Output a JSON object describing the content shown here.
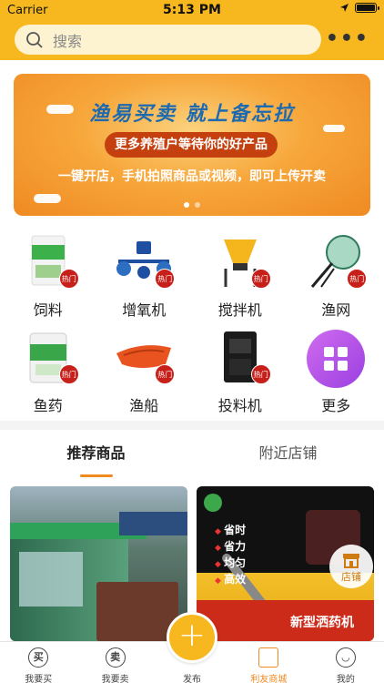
{
  "status_bar": {
    "carrier": "Carrier",
    "time": "5:13 PM",
    "battery_level": 1.0
  },
  "header": {
    "search_placeholder": "搜索",
    "more_icon": "ellipsis-icon"
  },
  "banner": {
    "title": "渔易买卖 就上备忘拉",
    "pill": "更多养殖户等待你的好产品",
    "subtitle": "一键开店，手机拍照商品或视频，即可上传开卖",
    "slide_count": 2,
    "active_slide": 1
  },
  "categories": [
    {
      "label": "饲料",
      "badge": "热门",
      "icon": "feed-bag-icon"
    },
    {
      "label": "增氧机",
      "badge": "热门",
      "icon": "aerator-icon"
    },
    {
      "label": "搅拌机",
      "badge": "热门",
      "icon": "mixer-icon"
    },
    {
      "label": "渔网",
      "badge": "热门",
      "icon": "fishing-net-icon"
    },
    {
      "label": "鱼药",
      "badge": "热门",
      "icon": "fish-medicine-icon"
    },
    {
      "label": "渔船",
      "badge": "热门",
      "icon": "boat-icon"
    },
    {
      "label": "投料机",
      "badge": "热门",
      "icon": "feeder-machine-icon"
    },
    {
      "label": "更多",
      "icon": "grid-icon"
    }
  ],
  "tabs": [
    {
      "label": "推荐商品",
      "active": true
    },
    {
      "label": "附近店铺",
      "active": false
    }
  ],
  "products": {
    "card2": {
      "bullets": [
        "省时",
        "省力",
        "均匀",
        "高效"
      ],
      "caption": "新型洒药机",
      "store_label": "店铺"
    }
  },
  "tabbar": [
    {
      "label": "我要买",
      "glyph": "买",
      "icon": "buy-icon"
    },
    {
      "label": "我要卖",
      "glyph": "卖",
      "icon": "sell-icon"
    },
    {
      "label": "发布",
      "icon": "plus-icon"
    },
    {
      "label": "利友商城",
      "icon": "shopping-bag-icon",
      "active": true
    },
    {
      "label": "我的",
      "icon": "smile-icon"
    }
  ],
  "colors": {
    "brand": "#f6b81e",
    "accent": "#ef8a22",
    "hot_badge": "#c7201a"
  }
}
